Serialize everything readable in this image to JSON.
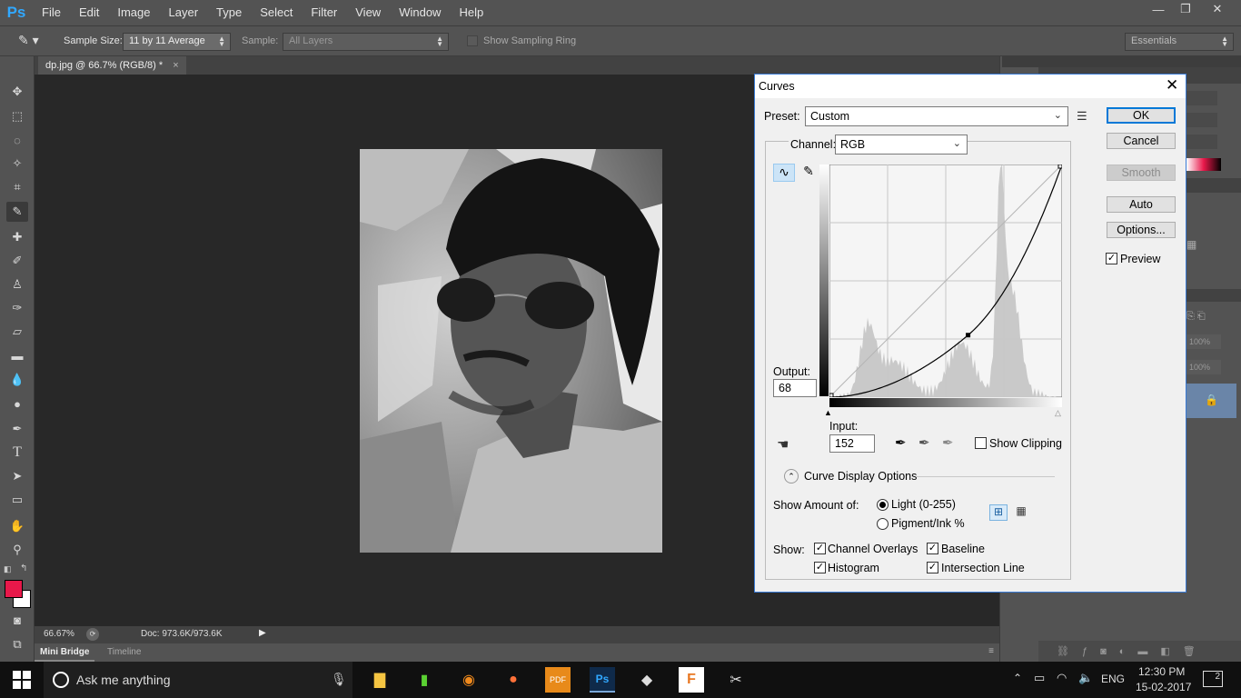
{
  "app": {
    "logo": "Ps",
    "menu": [
      "File",
      "Edit",
      "Image",
      "Layer",
      "Type",
      "Select",
      "Filter",
      "View",
      "Window",
      "Help"
    ],
    "window_controls": [
      "—",
      "❐",
      "✕"
    ]
  },
  "options_bar": {
    "sample_size_label": "Sample Size:",
    "sample_size_value": "11 by 11 Average",
    "sample_label": "Sample:",
    "sample_value": "All Layers",
    "show_sampling_ring": "Show Sampling Ring",
    "workspace": "Essentials"
  },
  "document": {
    "tab_title": "dp.jpg @ 66.7% (RGB/8) *",
    "zoom": "66.67%",
    "doc_size": "Doc: 973.6K/973.6K"
  },
  "bottom_tabs": [
    "Mini Bridge",
    "Timeline"
  ],
  "right_panel": {
    "opacity_1": "100%",
    "opacity_2": "100%"
  },
  "curves": {
    "title": "Curves",
    "preset_label": "Preset:",
    "preset_value": "Custom",
    "channel_label": "Channel:",
    "channel_value": "RGB",
    "output_label": "Output:",
    "output_value": "68",
    "input_label": "Input:",
    "input_value": "152",
    "show_clipping": "Show Clipping",
    "display_options": "Curve Display Options",
    "show_amount_label": "Show Amount of:",
    "light_option": "Light  (0-255)",
    "pigment_option": "Pigment/Ink %",
    "show_label": "Show:",
    "channel_overlays": "Channel Overlays",
    "baseline": "Baseline",
    "histogram": "Histogram",
    "intersection_line": "Intersection Line",
    "buttons": {
      "ok": "OK",
      "cancel": "Cancel",
      "smooth": "Smooth",
      "auto": "Auto",
      "options": "Options..."
    },
    "preview": "Preview",
    "control_point": {
      "input": 152,
      "output": 68
    }
  },
  "taskbar": {
    "search_placeholder": "Ask me anything",
    "language": "ENG",
    "time": "12:30 PM",
    "date": "15-02-2017",
    "notification_count": "2"
  },
  "colors": {
    "foreground_color": "#e8184a",
    "background_color": "#ffffff",
    "accent": "#0078d7"
  }
}
